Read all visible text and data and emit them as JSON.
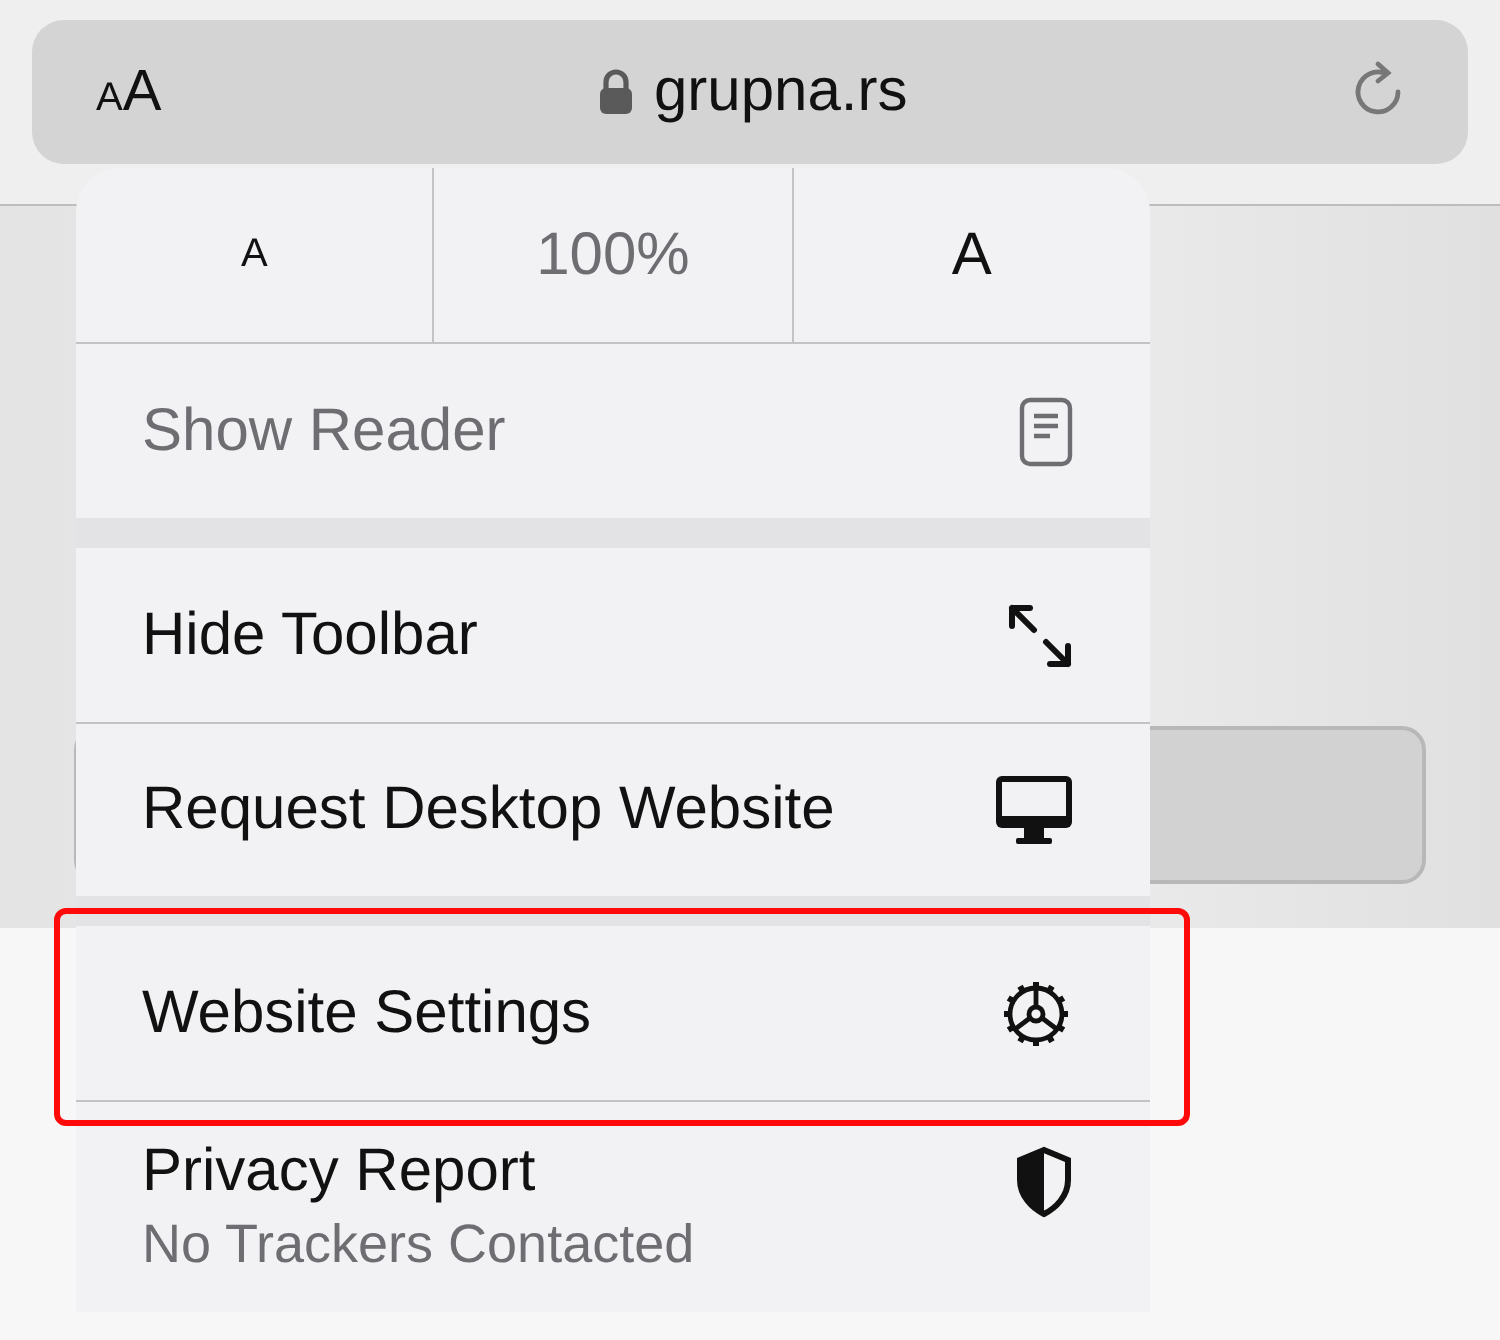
{
  "address_bar": {
    "text_size_small": "A",
    "text_size_large": "A",
    "url": "grupna.rs"
  },
  "zoom": {
    "decrease": "A",
    "level": "100%",
    "increase": "A"
  },
  "groups": [
    [
      {
        "kind": "reader",
        "label": "Show Reader",
        "disabled": true,
        "highlighted": false
      }
    ],
    [
      {
        "kind": "fullscreen",
        "label": "Hide Toolbar",
        "disabled": false,
        "highlighted": false
      },
      {
        "kind": "desktop",
        "label": "Request Desktop Website",
        "disabled": false,
        "highlighted": false
      }
    ],
    [
      {
        "kind": "settings",
        "label": "Website Settings",
        "disabled": false,
        "highlighted": true
      },
      {
        "kind": "privacy",
        "label": "Privacy Report",
        "subtitle": "No Trackers Contacted",
        "disabled": false,
        "highlighted": false
      }
    ]
  ]
}
